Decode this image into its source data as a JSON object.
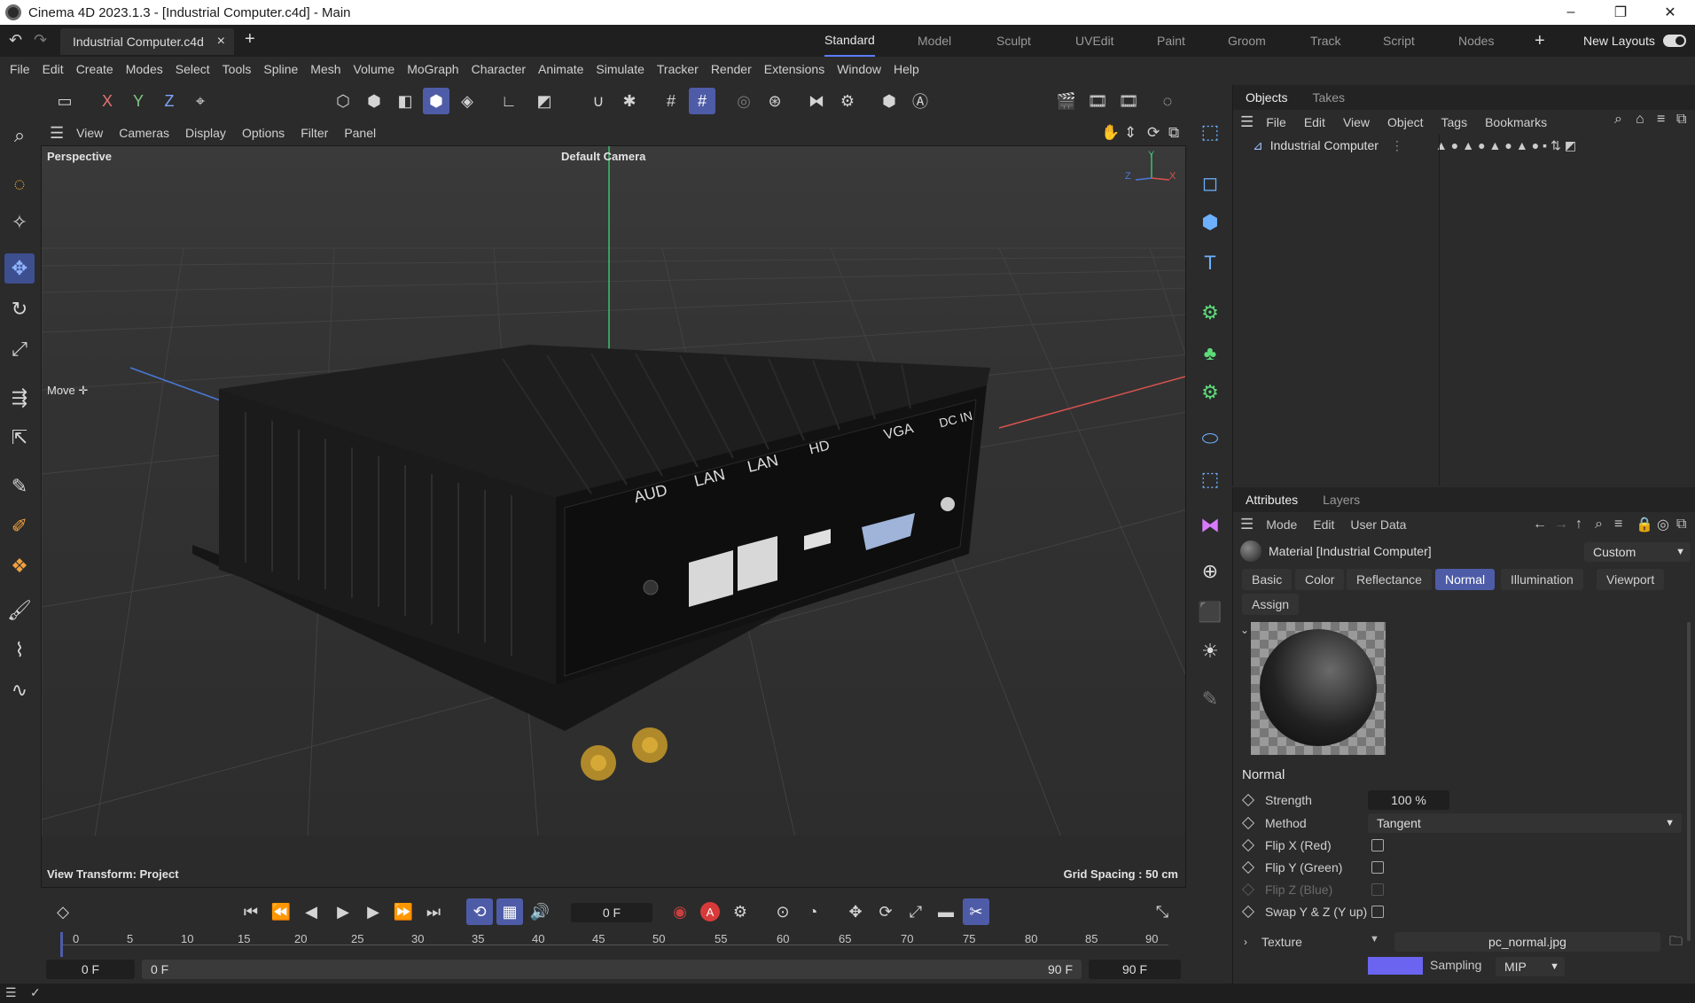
{
  "window": {
    "title": "Cinema 4D 2023.1.3 - [Industrial Computer.c4d] - Main",
    "minimize": "–",
    "maximize": "❐",
    "close": "✕"
  },
  "document_tab": {
    "label": "Industrial Computer.c4d",
    "close": "×",
    "add": "+"
  },
  "layout_tabs": [
    "Standard",
    "Model",
    "Sculpt",
    "UVEdit",
    "Paint",
    "Groom",
    "Track",
    "Script",
    "Nodes"
  ],
  "layout_active": "Standard",
  "new_layouts": "New Layouts",
  "menubar": [
    "File",
    "Edit",
    "Create",
    "Modes",
    "Select",
    "Tools",
    "Spline",
    "Mesh",
    "Volume",
    "MoGraph",
    "Character",
    "Animate",
    "Simulate",
    "Tracker",
    "Render",
    "Extensions",
    "Window",
    "Help"
  ],
  "toolbar_axes": [
    "X",
    "Y",
    "Z"
  ],
  "viewport": {
    "menu": [
      "View",
      "Cameras",
      "Display",
      "Options",
      "Filter",
      "Panel"
    ],
    "projection": "Perspective",
    "camera": "Default Camera",
    "tool_hint": "Move",
    "view_transform": "View Transform: Project",
    "grid_spacing": "Grid Spacing : 50 cm",
    "model_labels": [
      "AUD",
      "LAN",
      "LAN",
      "HD",
      "VGA",
      "DC IN"
    ],
    "axis_labels": {
      "y": "Y",
      "z": "Z",
      "x": "X"
    }
  },
  "objects_panel": {
    "tabs": [
      "Objects",
      "Takes"
    ],
    "menu": [
      "File",
      "Edit",
      "View",
      "Object",
      "Tags",
      "Bookmarks"
    ],
    "item": "Industrial Computer"
  },
  "attributes_panel": {
    "tabs": [
      "Attributes",
      "Layers"
    ],
    "menu": [
      "Mode",
      "Edit",
      "User Data"
    ],
    "title": "Material [Industrial Computer]",
    "mode_select": "Custom",
    "channel_tabs": [
      "Basic",
      "Color",
      "Reflectance",
      "Normal",
      "Illumination",
      "Viewport"
    ],
    "channel_active": "Normal",
    "assign": "Assign",
    "section": "Normal",
    "params": {
      "strength_label": "Strength",
      "strength_value": "100 %",
      "method_label": "Method",
      "method_value": "Tangent",
      "flipx_label": "Flip X (Red)",
      "flipy_label": "Flip Y (Green)",
      "flipz_label": "Flip Z (Blue)",
      "swap_label": "Swap Y & Z (Y up)",
      "texture_label": "Texture",
      "texture_file": "pc_normal.jpg",
      "sampling_label": "Sampling",
      "sampling_value": "MIP"
    }
  },
  "timeline": {
    "current_frame": "0 F",
    "ruler_ticks": [
      "0",
      "5",
      "10",
      "15",
      "20",
      "25",
      "30",
      "35",
      "40",
      "45",
      "50",
      "55",
      "60",
      "65",
      "70",
      "75",
      "80",
      "85",
      "90"
    ],
    "start": "0 F",
    "range_start": "0 F",
    "range_end": "90 F",
    "end": "90 F"
  },
  "colors": {
    "accent": "#4e5ca8",
    "axis_x": "#d9534f",
    "axis_y": "#3fbf6f",
    "axis_z": "#4a78d8"
  }
}
